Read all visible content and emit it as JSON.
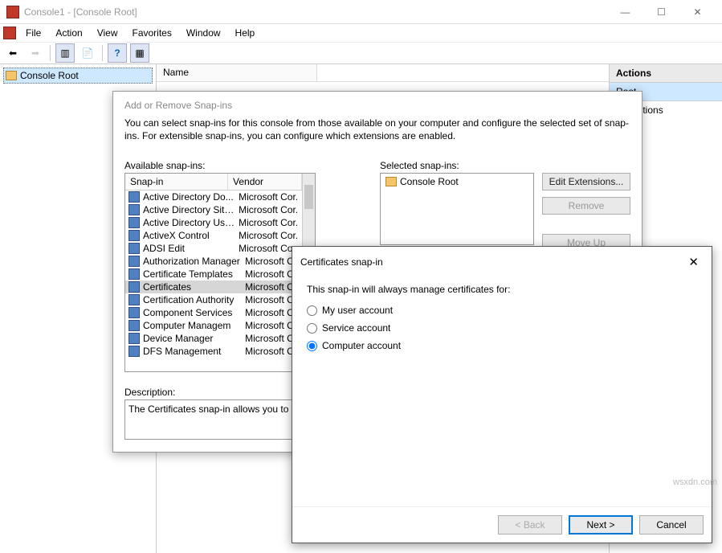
{
  "window": {
    "title": "Console1 - [Console Root]"
  },
  "menu": {
    "file": "File",
    "action": "Action",
    "view": "View",
    "favorites": "Favorites",
    "window": "Window",
    "help": "Help"
  },
  "tree": {
    "root": "Console Root"
  },
  "columns": {
    "name": "Name"
  },
  "actions": {
    "header": "Actions",
    "group": "Root",
    "more": "e Actions"
  },
  "dlg1": {
    "title": "Add or Remove Snap-ins",
    "intro": "You can select snap-ins for this console from those available on your computer and configure the selected set of snap-ins. For extensible snap-ins, you can configure which extensions are enabled.",
    "availLabel": "Available snap-ins:",
    "selLabel": "Selected snap-ins:",
    "snapinHdr": "Snap-in",
    "vendorHdr": "Vendor",
    "selectedRoot": "Console Root",
    "editExt": "Edit Extensions...",
    "remove": "Remove",
    "moveUp": "Move Up",
    "descLabel": "Description:",
    "descText": "The Certificates snap-in allows you to bro",
    "snapins": [
      {
        "n": "Active Directory Do...",
        "v": "Microsoft Cor..."
      },
      {
        "n": "Active Directory Site...",
        "v": "Microsoft Cor..."
      },
      {
        "n": "Active Directory Use...",
        "v": "Microsoft Cor..."
      },
      {
        "n": "ActiveX Control",
        "v": "Microsoft Cor..."
      },
      {
        "n": "ADSI Edit",
        "v": "Microsoft Cor..."
      },
      {
        "n": "Authorization Manager",
        "v": "Microsoft Co"
      },
      {
        "n": "Certificate Templates",
        "v": "Microsoft Co"
      },
      {
        "n": "Certificates",
        "v": "Microsoft Co",
        "sel": true
      },
      {
        "n": "Certification Authority",
        "v": "Microsoft Co"
      },
      {
        "n": "Component Services",
        "v": "Microsoft Co"
      },
      {
        "n": "Computer Managem",
        "v": "Microsoft Co"
      },
      {
        "n": "Device Manager",
        "v": "Microsoft Co"
      },
      {
        "n": "DFS Management",
        "v": "Microsoft Co"
      }
    ]
  },
  "dlg2": {
    "title": "Certificates snap-in",
    "prompt": "This snap-in will always manage certificates for:",
    "opt1": "My user account",
    "opt2": "Service account",
    "opt3": "Computer account",
    "back": "< Back",
    "next": "Next >",
    "cancel": "Cancel"
  },
  "watermark": "wsxdn.com"
}
